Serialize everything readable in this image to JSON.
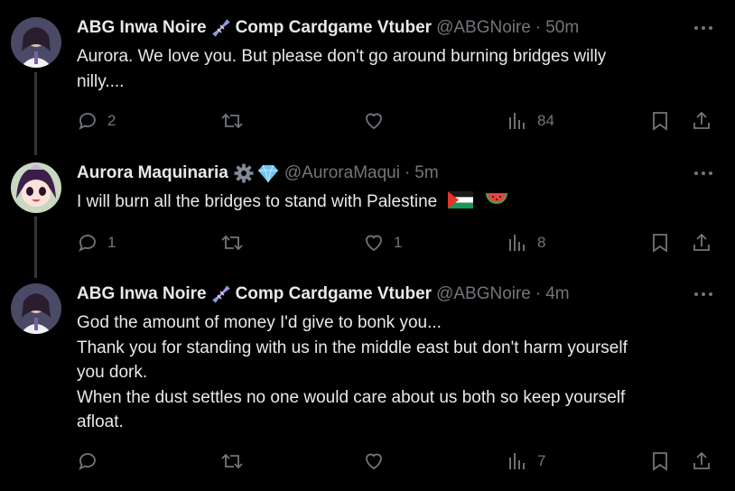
{
  "tweets": [
    {
      "name": "ABG Inwa Noire",
      "name_suffix": "Comp Cardgame Vtuber",
      "handle": "@ABGNoire",
      "time": "50m",
      "text_lines": [
        "Aurora. We love you. But please don't go around burning bridges willy",
        "nilly...."
      ],
      "reply_count": "2",
      "repost_count": "",
      "like_count": "",
      "view_count": "84"
    },
    {
      "name": "Aurora Maquinaria",
      "name_suffix": "",
      "handle": "@AuroraMaqui",
      "time": "5m",
      "text_lines": [
        "I will burn all the bridges to stand with Palestine"
      ],
      "reply_count": "1",
      "repost_count": "",
      "like_count": "1",
      "view_count": "8"
    },
    {
      "name": "ABG Inwa Noire",
      "name_suffix": "Comp Cardgame Vtuber",
      "handle": "@ABGNoire",
      "time": "4m",
      "text_lines": [
        "God the amount of money I'd give to bonk you...",
        "Thank you for standing with us in the middle east but don't harm yourself",
        "you dork.",
        "When the dust settles no one would care about us both so keep yourself",
        "afloat."
      ],
      "reply_count": "",
      "repost_count": "",
      "like_count": "",
      "view_count": "7"
    }
  ],
  "separator": "·",
  "icons": {
    "dna": "dna-icon",
    "gear": "gear-icon",
    "gem": "gem-icon",
    "flag": "palestine-flag-icon",
    "watermelon": "watermelon-icon"
  },
  "colors": {
    "background": "#000000",
    "text": "#e7e9ea",
    "muted": "#71767b",
    "thread_line": "#333639"
  }
}
